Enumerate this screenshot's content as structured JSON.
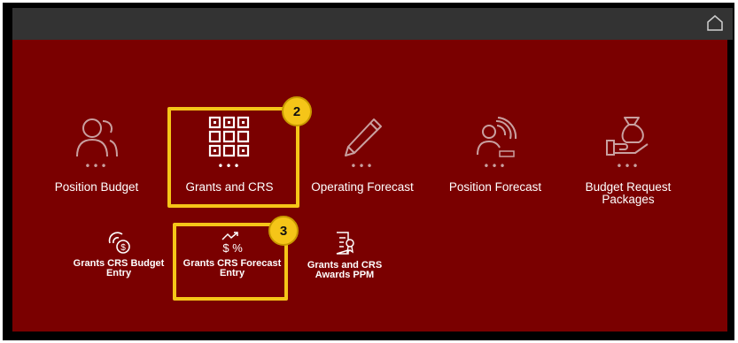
{
  "header": {
    "home_icon": "home-icon"
  },
  "tiles": [
    {
      "label": "Position Budget",
      "icon": "people-icon"
    },
    {
      "label": "Grants and CRS",
      "icon": "grid-icon"
    },
    {
      "label": "Operating Forecast",
      "icon": "pencil-icon"
    },
    {
      "label": "Position Forecast",
      "icon": "person-target-icon"
    },
    {
      "label": "Budget Request Packages",
      "icon": "money-bag-hand-icon"
    }
  ],
  "sub_tiles": [
    {
      "label": "Grants CRS Budget Entry",
      "icon": "budget-coins-icon"
    },
    {
      "label": "Grants CRS Forecast Entry",
      "icon": "trend-dollar-percent-icon"
    },
    {
      "label": "Grants and CRS Awards PPM",
      "icon": "document-award-icon"
    }
  ],
  "dots": "•••",
  "annotations": [
    {
      "number": "2"
    },
    {
      "number": "3"
    }
  ],
  "colors": {
    "background": "#7a0000",
    "topbar": "#333333",
    "highlight": "#f5c518"
  }
}
